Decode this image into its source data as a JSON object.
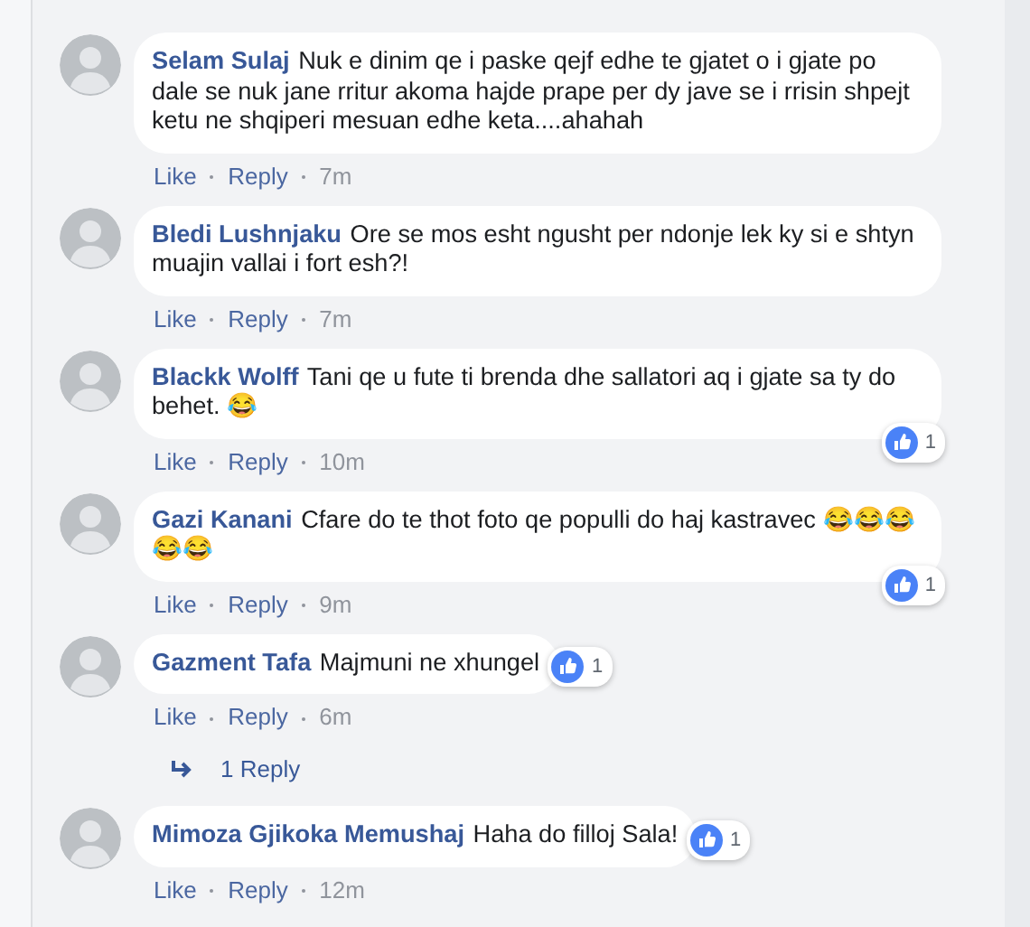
{
  "comments": [
    {
      "author": "Selam Sulaj",
      "text": "Nuk e dinim qe i paske qejf edhe te gjatet o i gjate po dale se nuk jane rritur akoma hajde prape per dy jave se i rrisin shpejt ketu ne shqiperi mesuan edhe keta....ahahah",
      "like": "Like",
      "reply": "Reply",
      "time": "7m"
    },
    {
      "author": "Bledi Lushnjaku",
      "text": "Ore se mos esht ngusht per ndonje lek ky si e shtyn muajin vallai i fort esh?!",
      "like": "Like",
      "reply": "Reply",
      "time": "7m"
    },
    {
      "author": "Blackk Wolff",
      "text": "Tani qe u fute ti brenda dhe sallatori aq i gjate sa ty do behet. 😂",
      "like": "Like",
      "reply": "Reply",
      "time": "10m",
      "reactions": "1"
    },
    {
      "author": "Gazi Kanani",
      "text": "Cfare do te thot foto qe populli do haj kastravec 😂😂😂😂😂",
      "like": "Like",
      "reply": "Reply",
      "time": "9m",
      "reactions": "1"
    },
    {
      "author": "Gazment Tafa",
      "text": "Majmuni ne xhungel",
      "like": "Like",
      "reply": "Reply",
      "time": "6m",
      "reactions": "1",
      "replies": "1 Reply"
    },
    {
      "author": "Mimoza Gjikoka Memushaj",
      "text": "Haha do filloj Sala!",
      "like": "Like",
      "reply": "Reply",
      "time": "12m",
      "reactions": "1"
    }
  ]
}
